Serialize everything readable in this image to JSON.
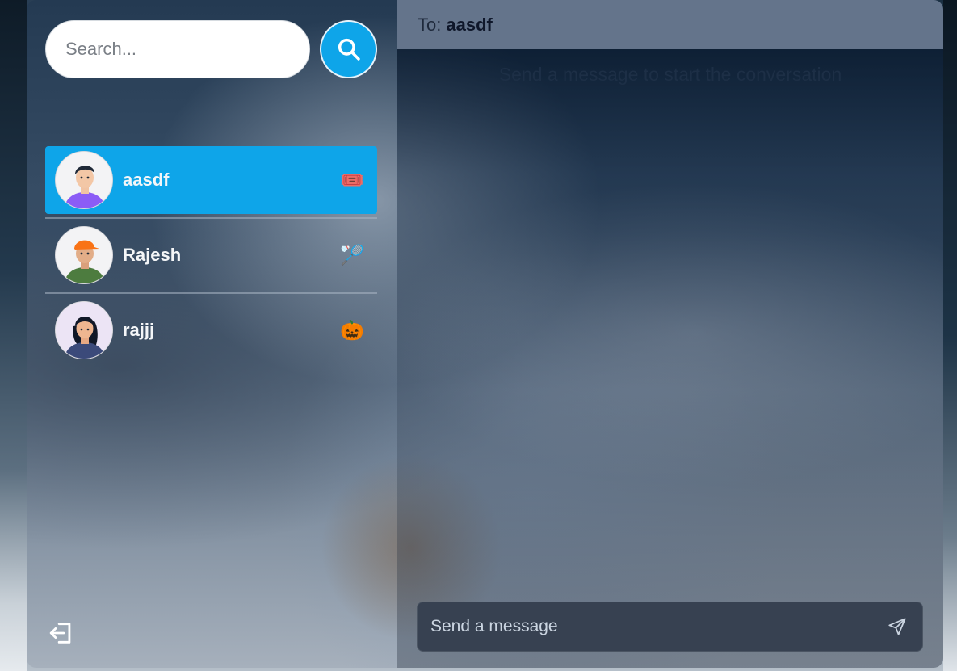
{
  "search": {
    "placeholder": "Search..."
  },
  "conversations": [
    {
      "name": "aasdf",
      "emoji": "🎟️",
      "selected": true,
      "avatar": "avatar-man-purple-shirt"
    },
    {
      "name": "Rajesh",
      "emoji": "🏸",
      "selected": false,
      "avatar": "avatar-man-orange-cap"
    },
    {
      "name": "rajjj",
      "emoji": "🎃",
      "selected": false,
      "avatar": "avatar-woman-blue-shirt"
    }
  ],
  "chat": {
    "to_label": "To:",
    "recipient": "aasdf",
    "empty_hint": "Send a message to start the conversation",
    "input_placeholder": "Send a message"
  },
  "icons": {
    "search": "search-icon",
    "send": "send-icon",
    "logout": "logout-icon"
  },
  "colors": {
    "accent": "#0ea5e9",
    "header": "#64748b",
    "composer": "#374151"
  }
}
